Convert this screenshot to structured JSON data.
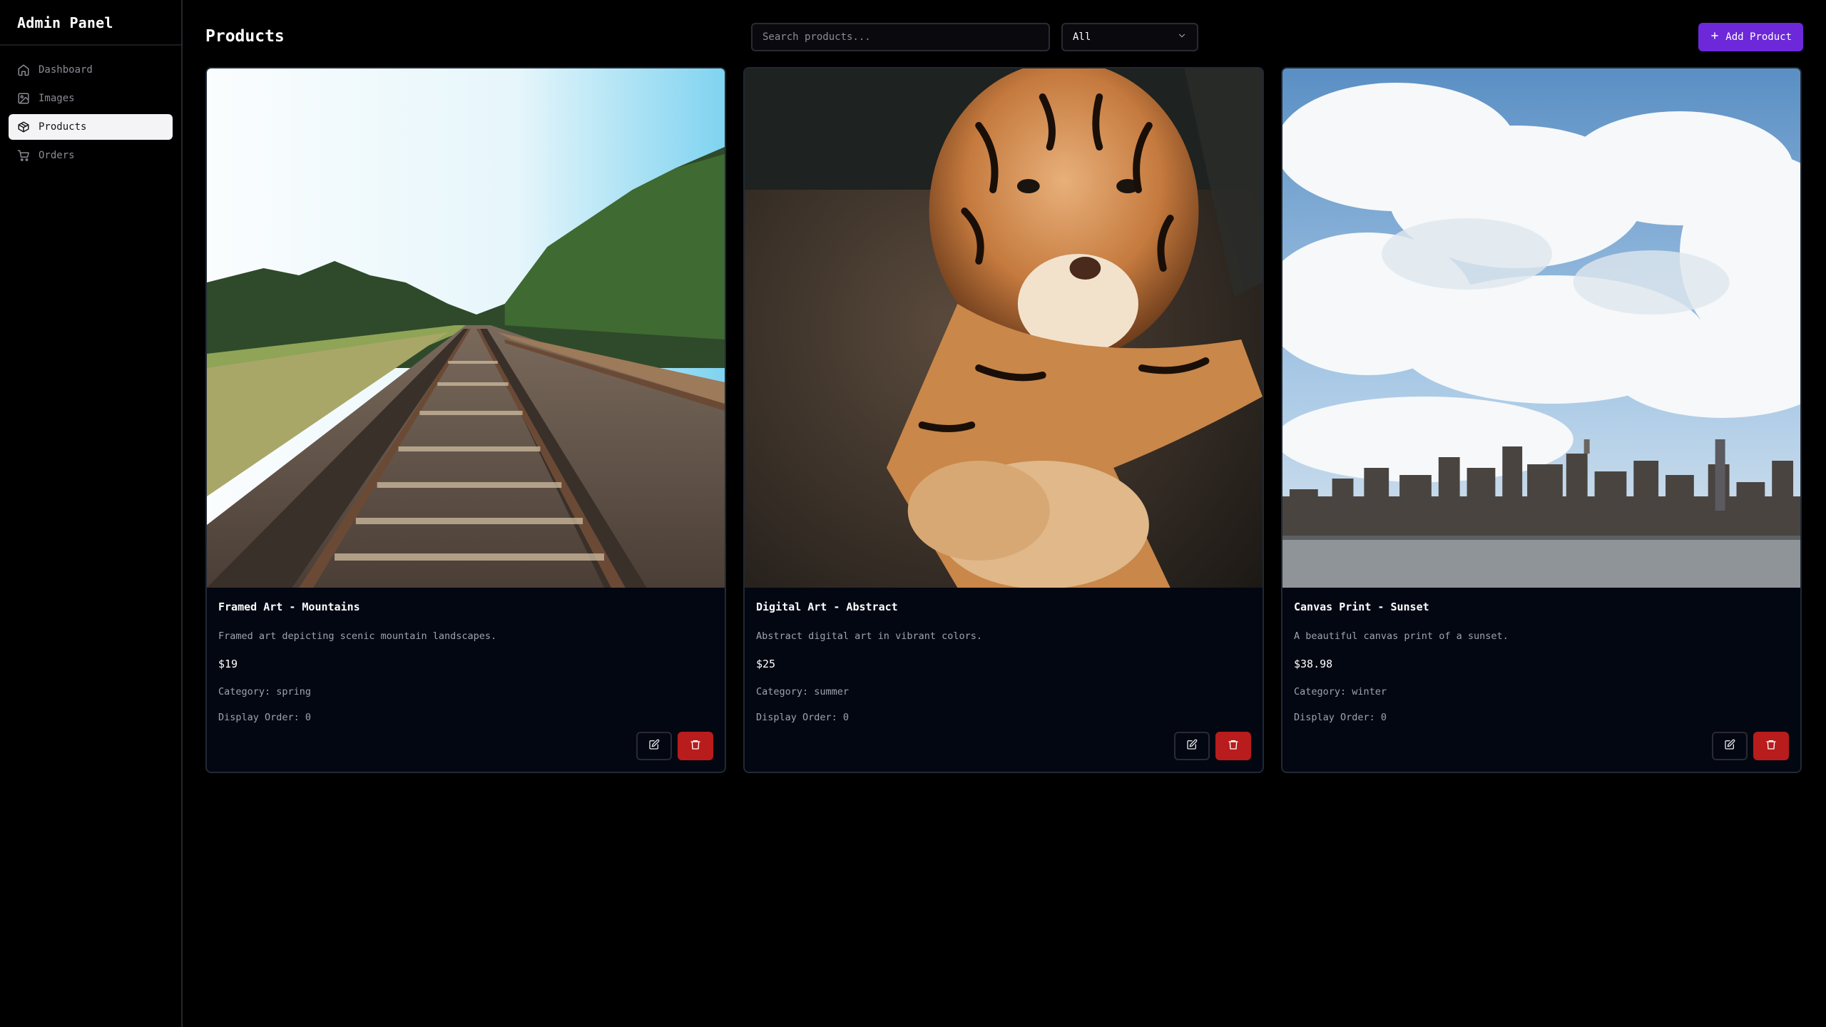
{
  "sidebar": {
    "title": "Admin Panel",
    "items": [
      {
        "label": "Dashboard",
        "icon": "home-icon",
        "active": false
      },
      {
        "label": "Images",
        "icon": "image-icon",
        "active": false
      },
      {
        "label": "Products",
        "icon": "package-icon",
        "active": true
      },
      {
        "label": "Orders",
        "icon": "cart-icon",
        "active": false
      }
    ]
  },
  "header": {
    "title": "Products",
    "search_placeholder": "Search products...",
    "search_value": "",
    "filter_value": "All",
    "add_label": "Add Product"
  },
  "products": [
    {
      "title": "Framed Art - Mountains",
      "description": "Framed art depicting scenic mountain landscapes.",
      "price": "$19",
      "category": "Category: spring",
      "order": "Display Order: 0",
      "image": "railway-tracks-photo"
    },
    {
      "title": "Digital Art - Abstract",
      "description": "Abstract digital art in vibrant colors.",
      "price": "$25",
      "category": "Category: summer",
      "order": "Display Order: 0",
      "image": "tiger-photo"
    },
    {
      "title": "Canvas Print - Sunset",
      "description": "A beautiful canvas print of a sunset.",
      "price": "$38.98",
      "category": "Category: winter",
      "order": "Display Order: 0",
      "image": "city-skyline-photo"
    }
  ],
  "colors": {
    "accent": "#6d28d9",
    "danger": "#b91c1c",
    "card_bg": "#030712"
  }
}
